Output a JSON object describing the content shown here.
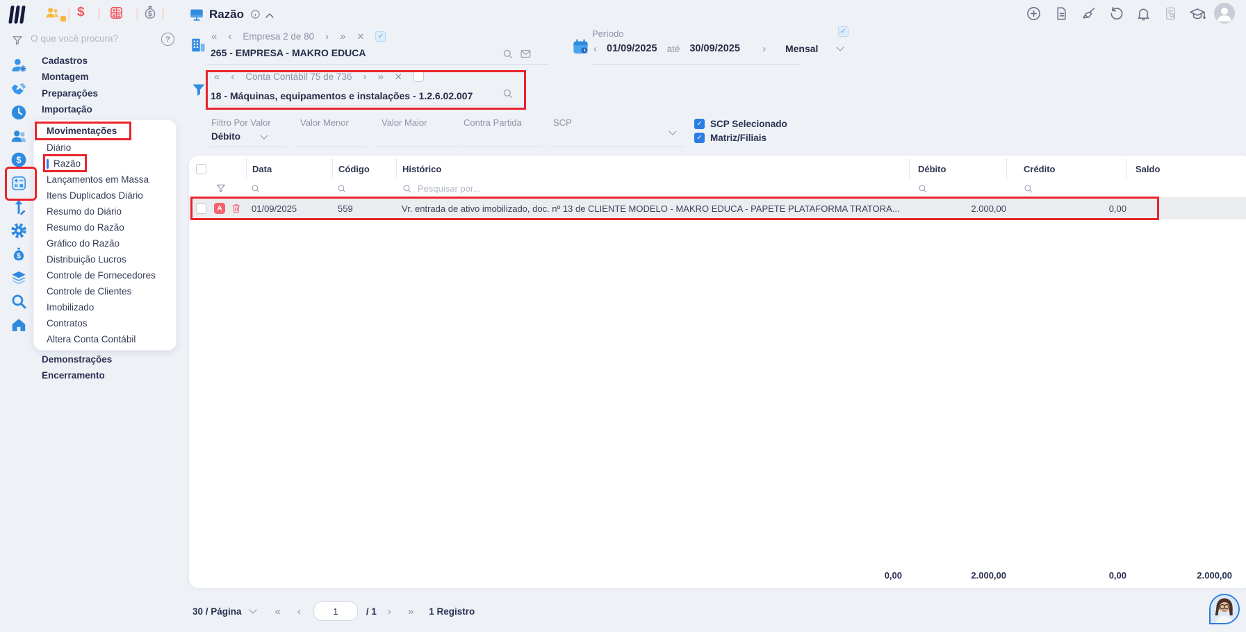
{
  "colors": {
    "accent_blue": "#2e8be0",
    "annotation_red": "#e8242b",
    "badge_red": "#f4626e",
    "navy": "#272c49"
  },
  "glyphs": {
    "first": "«",
    "prev": "‹",
    "next": "›",
    "last": "»",
    "close": "✕",
    "check": "✓",
    "question": "?",
    "dollar": "$"
  },
  "topbar": {
    "title": "Razão"
  },
  "sidebar": {
    "search_placeholder": "O que você procura?",
    "items_top": [
      "Cadastros",
      "Montagem",
      "Preparações",
      "Importação"
    ],
    "movimentacoes_label": "Movimentações",
    "submenu": [
      "Diário",
      "Razão",
      "Lançamentos em Massa",
      "Itens Duplicados Diário",
      "Resumo do Diário",
      "Resumo do Razão",
      "Gráfico do Razão",
      "Distribuição Lucros",
      "Controle de Fornecedores",
      "Controle de Clientes",
      "Imobilizado",
      "Contratos",
      "Altera Conta Contábil"
    ],
    "items_bottom": [
      "Demonstrações",
      "Encerramento"
    ]
  },
  "company_nav": {
    "label": "Empresa 2 de 80",
    "value": "265 - EMPRESA - MAKRO EDUCA"
  },
  "account_nav": {
    "label": "Conta Contábil 75 de 736",
    "value": "18 - Máquinas, equipamentos e instalações - 1.2.6.02.007"
  },
  "period": {
    "label": "Período",
    "start_date": "01/09/2025",
    "until_label": "até",
    "end_date": "30/09/2025",
    "mode": "Mensal"
  },
  "filters": {
    "filtro_por_valor_label": "Filtro Por Valor",
    "filtro_por_valor_value": "Débito",
    "valor_menor_label": "Valor Menor",
    "valor_maior_label": "Valor Maior",
    "contra_partida_label": "Contra Partida",
    "scp_label": "SCP",
    "scp_selecionado_label": "SCP Selecionado",
    "matriz_filiais_label": "Matriz/Filiais"
  },
  "table": {
    "columns": {
      "data": "Data",
      "codigo": "Código",
      "historico": "Histórico",
      "debito": "Débito",
      "credito": "Crédito",
      "saldo": "Saldo"
    },
    "search_placeholder": "Pesquisar por...",
    "row": {
      "badge": "A",
      "data": "01/09/2025",
      "codigo": "559",
      "historico": "Vr. entrada de ativo imobilizado, doc. nº 13 de CLIENTE MODELO - MAKRO EDUCA - PAPETE PLATAFORMA TRATORA...",
      "debito": "2.000,00",
      "credito": "0,00"
    },
    "totals": {
      "historico_total": "0,00",
      "debito_total": "2.000,00",
      "credito_total": "0,00",
      "saldo_total": "2.000,00"
    }
  },
  "pagination": {
    "page_size": "30 / Página",
    "page_value": "1",
    "page_total": "/ 1",
    "records": "1 Registro"
  }
}
